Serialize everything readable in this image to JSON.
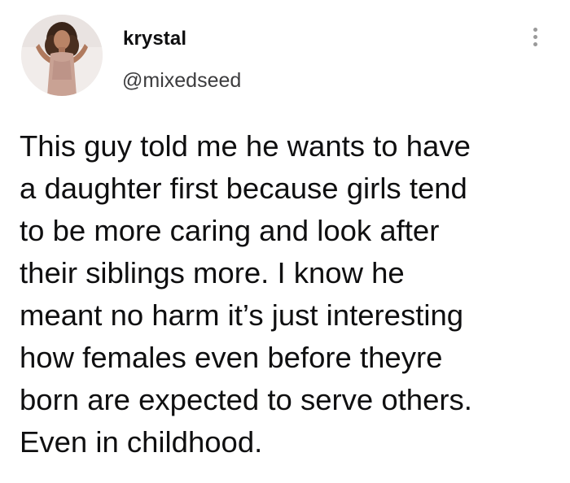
{
  "user": {
    "display_name": "krystal",
    "handle": "@mixedseed",
    "avatar_icon": "profile-photo"
  },
  "menu": {
    "icon": "more-vertical-icon"
  },
  "tweet": {
    "text": "This guy told me he wants to have\na daughter first because girls tend\nto be more caring and look after\ntheir siblings more. I know he\nmeant no harm it’s just interesting\nhow females even before theyre\nborn are expected to serve others.\nEven in childhood."
  },
  "colors": {
    "background": "#ffffff",
    "text": "#0f0f10",
    "handle": "#3c3c3e",
    "menu_dots": "#9a9a9a"
  }
}
